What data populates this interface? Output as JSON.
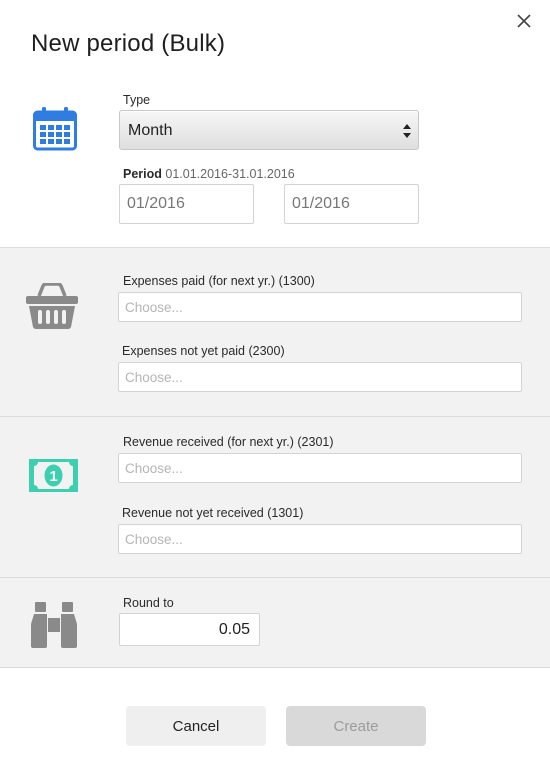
{
  "dialog": {
    "title": "New period (Bulk)"
  },
  "period": {
    "type_label": "Type",
    "type_value": "Month",
    "period_label": "Period",
    "period_range": "01.01.2016-31.01.2016",
    "from_value": "01/2016",
    "to_value": "01/2016"
  },
  "expenses": {
    "paid_label": "Expenses paid (for next yr.) (1300)",
    "paid_placeholder": "Choose...",
    "not_paid_label": "Expenses not yet paid (2300)",
    "not_paid_placeholder": "Choose..."
  },
  "revenue": {
    "received_label": "Revenue received (for next yr.) (2301)",
    "received_placeholder": "Choose...",
    "not_received_label": "Revenue not yet received (1301)",
    "not_received_placeholder": "Choose..."
  },
  "rounding": {
    "label": "Round to",
    "value": "0.05"
  },
  "buttons": {
    "cancel": "Cancel",
    "create": "Create"
  },
  "icons": {
    "close": "close-icon",
    "calendar": "calendar-icon",
    "basket": "basket-icon",
    "money": "money-icon",
    "binoculars": "binoculars-icon"
  },
  "colors": {
    "calendar_blue": "#2f7de1",
    "money_teal": "#3ccfb0",
    "icon_gray": "#8a8a8a"
  }
}
